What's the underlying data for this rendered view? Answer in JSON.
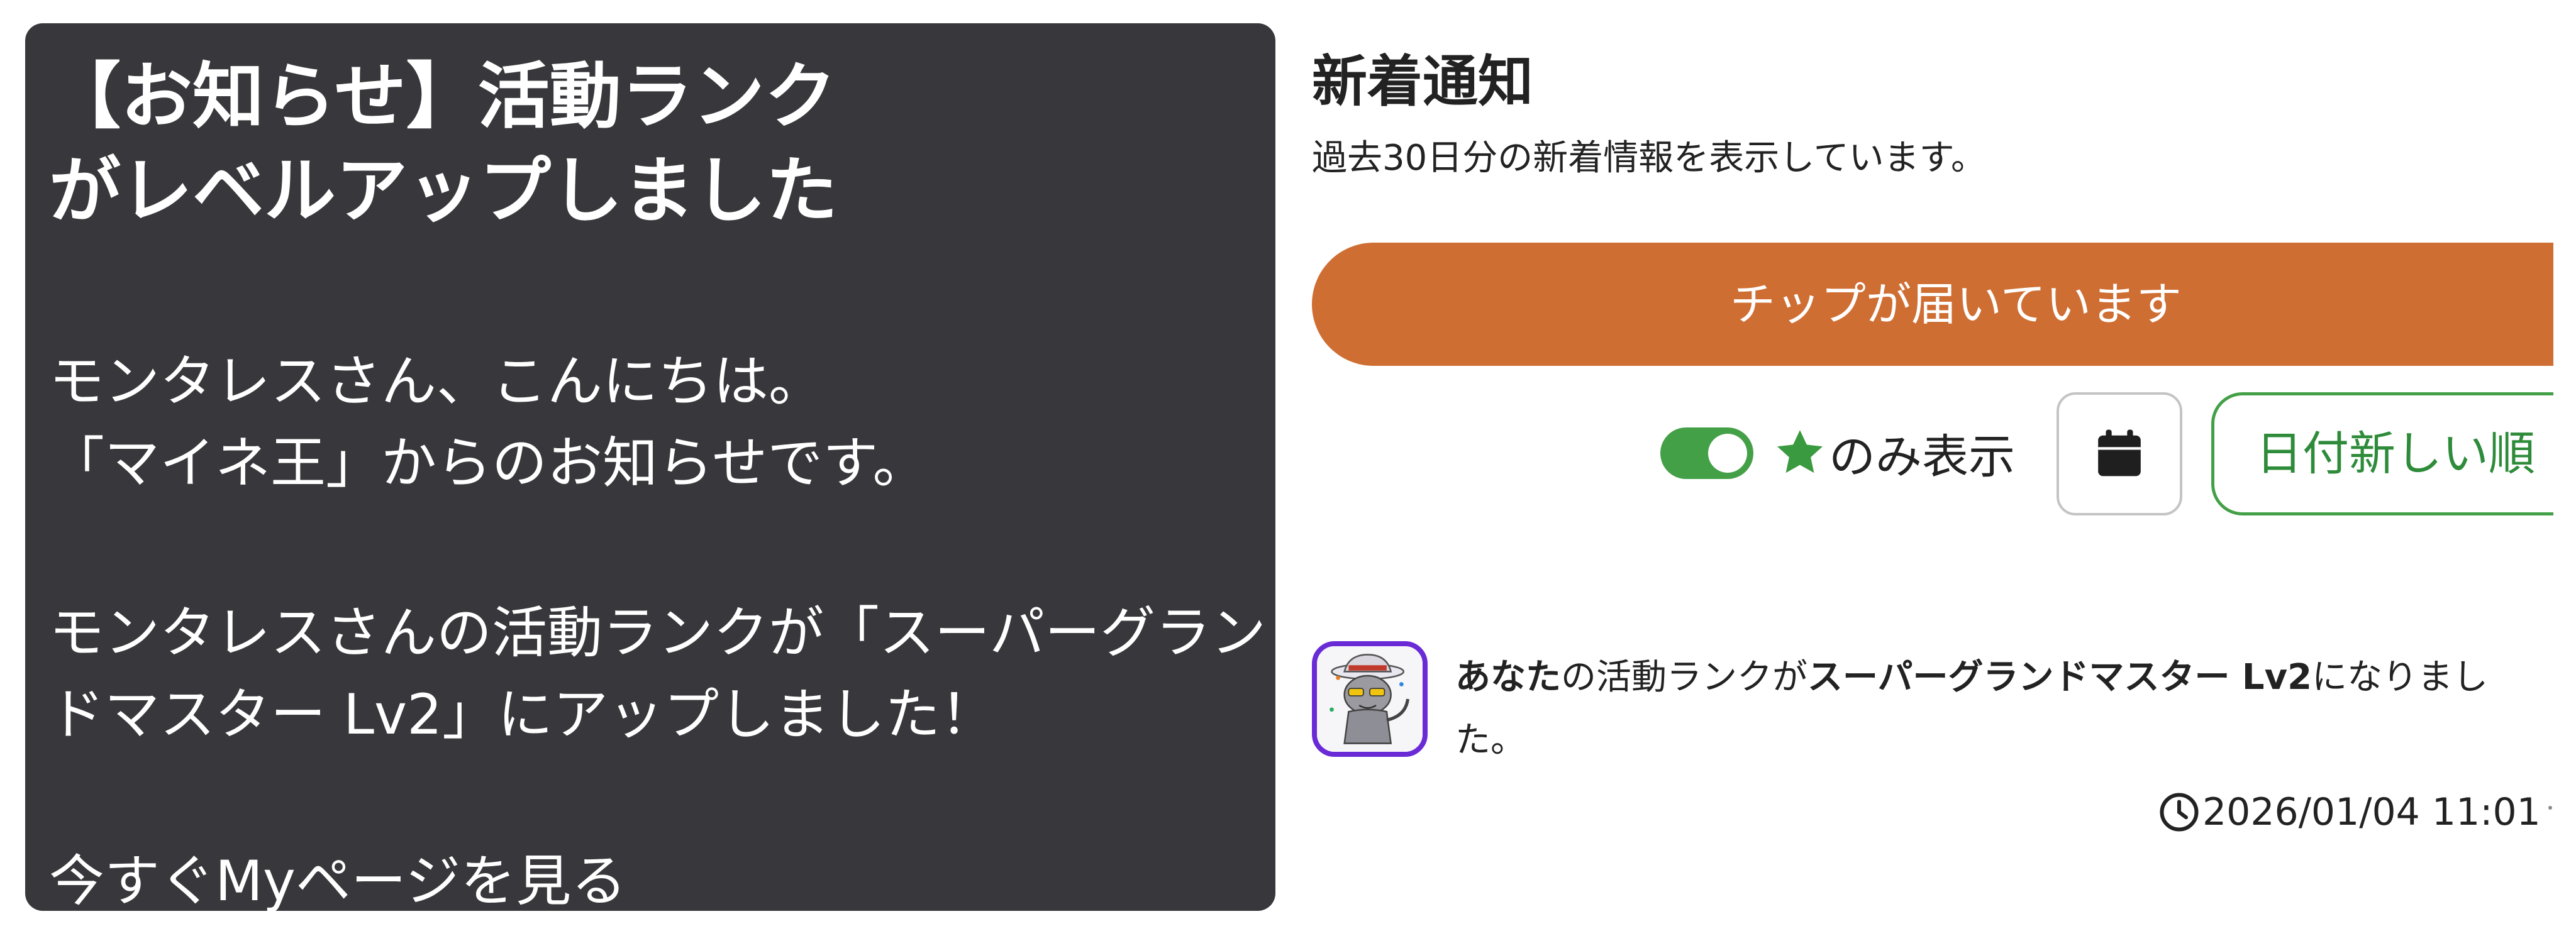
{
  "announcement": {
    "title_line1": "【お知らせ】活動ランク",
    "title_line2": "がレベルアップしました",
    "greeting": "モンタレスさん、こんにちは。",
    "from_line": "「マイネ王」からのお知らせです。",
    "rank_line1": "モンタレスさんの活動ランクが「スーパーグラン",
    "rank_line2": "ドマスター Lv2」にアップしました！",
    "mypage_link": "今すぐMyページを見る"
  },
  "notifications_page": {
    "title": "新着通知",
    "subtitle": "過去30日分の新着情報を表示しています。",
    "tip_banner": "チップが届いています",
    "filter": {
      "toggle_on": true,
      "star_only_label": "のみ表示",
      "star_icon": "star-icon",
      "calendar_icon": "calendar-icon",
      "sort_label": "日付新しい順"
    },
    "items": [
      {
        "text_you": "あなた",
        "text_mid": "の活動ランクが",
        "text_rank": "スーパーグランドマスター Lv2",
        "text_end": "になりました。",
        "time": "2026/01/04 11:01",
        "time_icon": "clock-icon"
      }
    ]
  },
  "colors": {
    "dark_panel": "#38373b",
    "tip_banner": "#cf6e33",
    "accent_green": "#43a047",
    "avatar_border": "#6a2bd6"
  }
}
